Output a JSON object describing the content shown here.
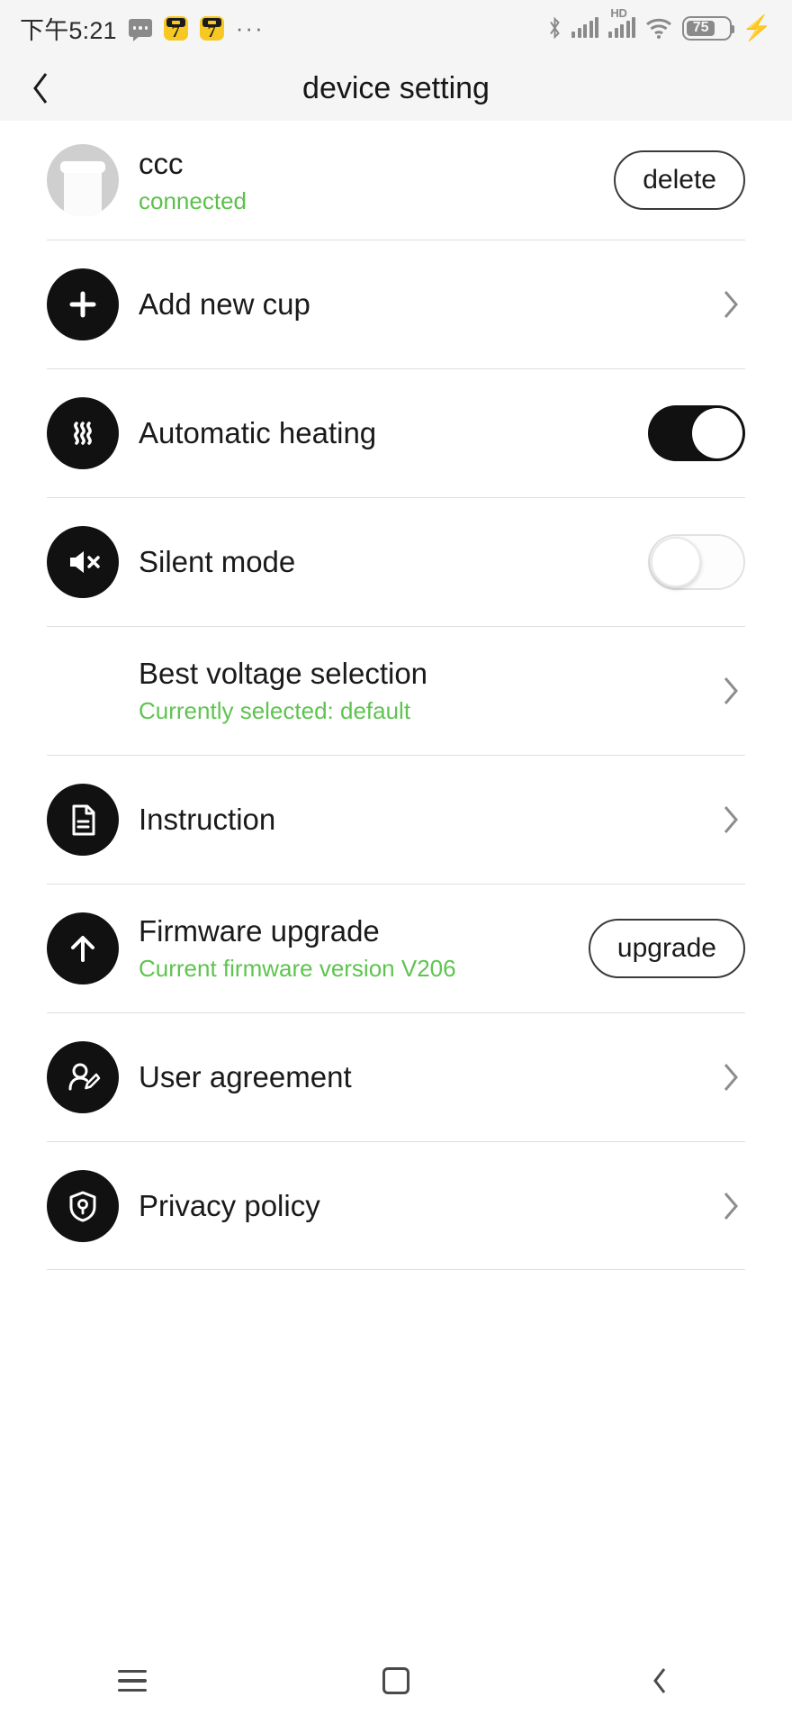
{
  "statusbar": {
    "time": "下午5:21",
    "overflow_dots": "···",
    "left_icons": [
      "message-icon",
      "app-7-icon",
      "app-7-icon"
    ],
    "right_icons": [
      "bluetooth-icon",
      "signal-icon",
      "hd-signal-icon",
      "wifi-icon",
      "battery-icon",
      "charging-bolt-icon"
    ],
    "hd_label": "HD",
    "battery_level": "75"
  },
  "header": {
    "title": "device setting",
    "back_icon": "chevron-left-icon"
  },
  "device": {
    "name": "ccc",
    "status": "connected",
    "delete_label": "delete",
    "avatar_icon": "cup-avatar"
  },
  "rows": [
    {
      "label": "Add new cup",
      "icon": "plus-icon",
      "accessory": "chevron"
    },
    {
      "label": "Automatic heating",
      "icon": "heat-waves-icon",
      "accessory": "toggle-on"
    },
    {
      "label": "Silent mode",
      "icon": "speaker-mute-icon",
      "accessory": "toggle-off"
    },
    {
      "label": "Best voltage selection",
      "sub": "Currently selected: default",
      "icon": "none",
      "accessory": "chevron"
    },
    {
      "label": "Instruction",
      "icon": "document-icon",
      "accessory": "chevron"
    },
    {
      "label": "Firmware upgrade",
      "sub": "Current firmware version V206",
      "icon": "arrow-up-icon",
      "accessory": "upgrade-button"
    },
    {
      "label": "User agreement",
      "icon": "user-edit-icon",
      "accessory": "chevron"
    },
    {
      "label": "Privacy policy",
      "icon": "shield-lock-icon",
      "accessory": "chevron"
    }
  ],
  "buttons": {
    "upgrade_label": "upgrade"
  },
  "navbar": {
    "menu": "menu-icon",
    "home": "home-icon",
    "back": "back-icon"
  },
  "colors": {
    "accent_green": "#5cc14b",
    "icon_bg": "#111111",
    "status_bar_bg": "#f5f5f5"
  }
}
